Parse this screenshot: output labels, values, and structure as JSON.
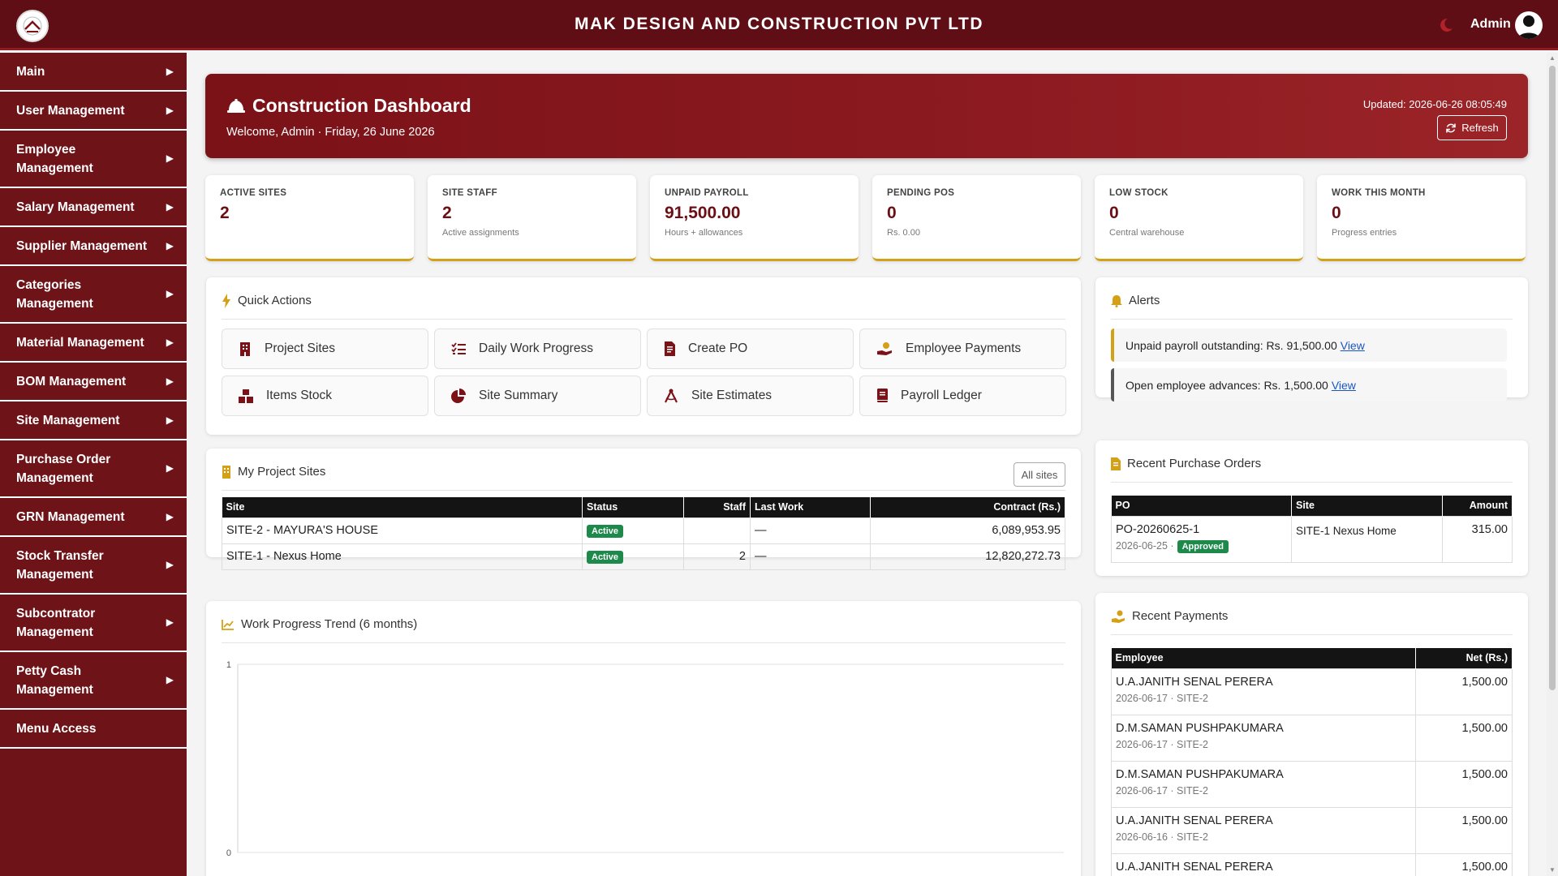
{
  "header": {
    "company": "MAK DESIGN AND CONSTRUCTION PVT LTD",
    "user": "Admin"
  },
  "sidebar": {
    "items": [
      {
        "label": "Main"
      },
      {
        "label": "User Management"
      },
      {
        "label": "Employee Management"
      },
      {
        "label": "Salary Management"
      },
      {
        "label": "Supplier Management"
      },
      {
        "label": "Categories Management"
      },
      {
        "label": "Material Management"
      },
      {
        "label": "BOM Management"
      },
      {
        "label": "Site Management"
      },
      {
        "label": "Purchase Order Management"
      },
      {
        "label": "GRN Management"
      },
      {
        "label": "Stock Transfer Management"
      },
      {
        "label": "Subcontrator Management"
      },
      {
        "label": "Petty Cash Management"
      },
      {
        "label": "Menu Access"
      }
    ]
  },
  "dashboard": {
    "title": "Construction Dashboard",
    "welcome": "Welcome, Admin · Friday, 26 June 2026",
    "updated": "Updated: 2026-06-26 08:05:49",
    "refresh_label": "Refresh"
  },
  "stats": [
    {
      "label": "ACTIVE SITES",
      "value": "2",
      "note": ""
    },
    {
      "label": "SITE STAFF",
      "value": "2",
      "note": "Active assignments"
    },
    {
      "label": "UNPAID PAYROLL",
      "value": "91,500.00",
      "note": "Hours + allowances"
    },
    {
      "label": "PENDING POS",
      "value": "0",
      "note": "Rs. 0.00"
    },
    {
      "label": "LOW STOCK",
      "value": "0",
      "note": "Central warehouse"
    },
    {
      "label": "WORK THIS MONTH",
      "value": "0",
      "note": "Progress entries"
    }
  ],
  "quick_actions": {
    "title": "Quick Actions",
    "items": [
      {
        "label": "Project Sites",
        "icon": "building-icon"
      },
      {
        "label": "Daily Work Progress",
        "icon": "list-check-icon"
      },
      {
        "label": "Create PO",
        "icon": "invoice-icon"
      },
      {
        "label": "Employee Payments",
        "icon": "hand-coin-icon"
      },
      {
        "label": "Items Stock",
        "icon": "boxes-icon"
      },
      {
        "label": "Site Summary",
        "icon": "pie-chart-icon"
      },
      {
        "label": "Site Estimates",
        "icon": "drafting-compass-icon"
      },
      {
        "label": "Payroll Ledger",
        "icon": "book-icon"
      }
    ]
  },
  "alerts": {
    "title": "Alerts",
    "items": [
      {
        "text": "Unpaid payroll outstanding: Rs. 91,500.00",
        "link": "View",
        "color": "#d4a017"
      },
      {
        "text": "Open employee advances: Rs. 1,500.00",
        "link": "View",
        "color": "#555555"
      }
    ]
  },
  "project_sites": {
    "title": "My Project Sites",
    "all_label": "All sites",
    "columns": [
      "Site",
      "Status",
      "Staff",
      "Last Work",
      "Contract (Rs.)"
    ],
    "rows": [
      {
        "site": "SITE-2 - MAYURA'S HOUSE",
        "status": "Active",
        "staff": "",
        "last_work": "—",
        "contract": "6,089,953.95"
      },
      {
        "site": "SITE-1 - Nexus Home",
        "status": "Active",
        "staff": "2",
        "last_work": "—",
        "contract": "12,820,272.73"
      }
    ]
  },
  "purchase_orders": {
    "title": "Recent Purchase Orders",
    "columns": [
      "PO",
      "Site",
      "Amount"
    ],
    "rows": [
      {
        "po": "PO-20260625-1",
        "date": "2026-06-25 ·",
        "status": "Approved",
        "site": "SITE-1 Nexus Home",
        "amount": "315.00"
      }
    ]
  },
  "trend": {
    "title": "Work Progress Trend (6 months)"
  },
  "chart_data": {
    "type": "line",
    "title": "Work Progress Trend (6 months)",
    "series": [],
    "ylim": [
      0,
      1
    ],
    "yticks": [
      "1",
      "0"
    ]
  },
  "payments": {
    "title": "Recent Payments",
    "columns": [
      "Employee",
      "Net (Rs.)"
    ],
    "rows": [
      {
        "name": "U.A.JANITH SENAL PERERA",
        "meta": "2026-06-17 · SITE-2",
        "net": "1,500.00"
      },
      {
        "name": "D.M.SAMAN PUSHPAKUMARA",
        "meta": "2026-06-17 · SITE-2",
        "net": "1,500.00"
      },
      {
        "name": "D.M.SAMAN PUSHPAKUMARA",
        "meta": "2026-06-17 · SITE-2",
        "net": "1,500.00"
      },
      {
        "name": "U.A.JANITH SENAL PERERA",
        "meta": "2026-06-16 · SITE-2",
        "net": "1,500.00"
      },
      {
        "name": "U.A.JANITH SENAL PERERA",
        "meta": "",
        "net": "1,500.00"
      }
    ]
  },
  "colors": {
    "brand": "#6e1318",
    "accent": "#d4a017",
    "success": "#1d8a4c"
  }
}
